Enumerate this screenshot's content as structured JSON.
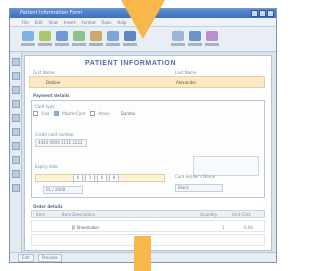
{
  "window": {
    "title": "Patient Information Form",
    "accent": "#4a6fa6",
    "highlight": "#f7b74a",
    "field_fill": "#fbe9c6"
  },
  "menu": [
    "File",
    "Edit",
    "View",
    "Insert",
    "Format",
    "Tools",
    "Help"
  ],
  "toolbar_buttons": [
    {
      "icon": "new-document-icon",
      "color": "#7fb2e0"
    },
    {
      "icon": "open-folder-icon",
      "color": "#a9c76a"
    },
    {
      "icon": "save-icon",
      "color": "#6f9bd1"
    },
    {
      "icon": "print-icon",
      "color": "#8fbf8a"
    },
    {
      "icon": "cut-icon",
      "color": "#c9a86a"
    },
    {
      "icon": "copy-icon",
      "color": "#7aa7d6"
    },
    {
      "icon": "paste-icon",
      "color": "#5f86bd"
    },
    {
      "icon": "undo-icon",
      "color": "#9bb6d8"
    },
    {
      "icon": "redo-icon",
      "color": "#6d91c9"
    },
    {
      "icon": "help-icon",
      "color": "#b88fd0"
    }
  ],
  "form": {
    "title": "PATIENT INFORMATION",
    "first_name_label": "First Name",
    "last_name_label": "Last Name",
    "first_name_value": "Debbie",
    "last_name_value": "Alexander",
    "section_label": "Payment details",
    "group_label": "Card type",
    "card_options": [
      "Visa",
      "MasterCard",
      "Amex"
    ],
    "cardholder_value": "Dumbo",
    "card_number_label": "Credit card number",
    "card_number_value": "4444 0000 1111 2222",
    "expiry_label": "Expiry date",
    "expiry_segments": [
      "0",
      "1",
      "0",
      "8"
    ],
    "expiry_value": "01 / 2008",
    "card_holder_name_label": "Card Holder's Name",
    "card_holder_name_value": "Black"
  },
  "order": {
    "section_label": "Order details",
    "columns": [
      "Item",
      "Item Description",
      "Quantity",
      "Unit Cost"
    ],
    "rows": [
      {
        "item": "",
        "description": "Jil Shoemaker",
        "quantity": "1",
        "unit_cost": "0.00"
      }
    ]
  },
  "status_tabs": [
    "Edit",
    "Preview"
  ]
}
